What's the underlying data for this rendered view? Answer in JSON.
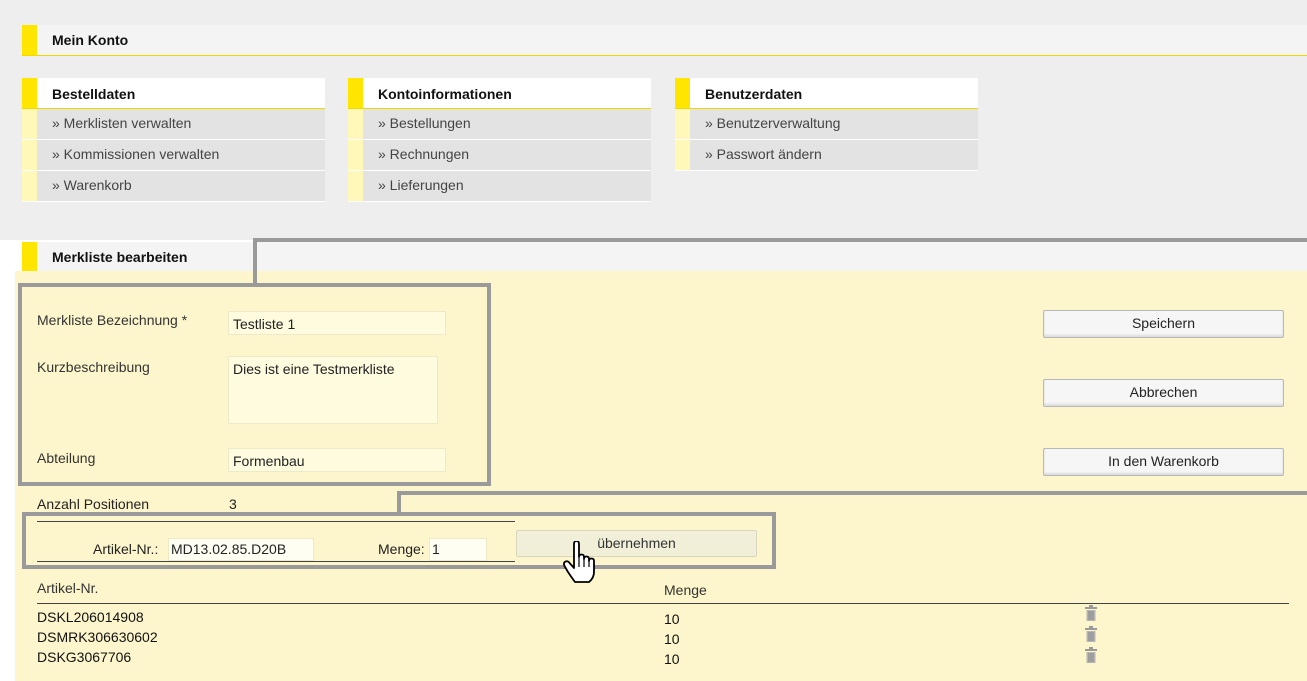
{
  "page": {
    "title": "Mein Konto"
  },
  "boxes": [
    {
      "title": "Bestelldaten",
      "items": [
        "» Merklisten verwalten",
        "» Kommissionen verwalten",
        "» Warenkorb"
      ]
    },
    {
      "title": "Kontoinformationen",
      "items": [
        "» Bestellungen",
        "» Rechnungen",
        "» Lieferungen"
      ]
    },
    {
      "title": "Benutzerdaten",
      "items": [
        "» Benutzerverwaltung",
        "» Passwort ändern"
      ]
    }
  ],
  "edit": {
    "title": "Merkliste bearbeiten",
    "name_label": "Merkliste Bezeichnung *",
    "name_value": "Testliste 1",
    "desc_label": "Kurzbeschreibung",
    "desc_value": "Dies ist eine Testmerkliste",
    "dept_label": "Abteilung",
    "dept_value": "Formenbau",
    "save": "Speichern",
    "cancel": "Abbrechen",
    "to_cart": "In den Warenkorb",
    "count_label": "Anzahl Positionen",
    "count_value": "3"
  },
  "quickadd": {
    "article_label": "Artikel-Nr.:",
    "article_value": "MD13.02.85.D20B",
    "qty_label": "Menge:",
    "qty_value": "1",
    "apply": "übernehmen"
  },
  "table": {
    "headers": [
      "Artikel-Nr.",
      "Menge"
    ],
    "rows": [
      {
        "article": "DSKL206014908",
        "qty": "10"
      },
      {
        "article": "DSMRK306630602",
        "qty": "10"
      },
      {
        "article": "DSKG3067706",
        "qty": "10"
      }
    ]
  }
}
